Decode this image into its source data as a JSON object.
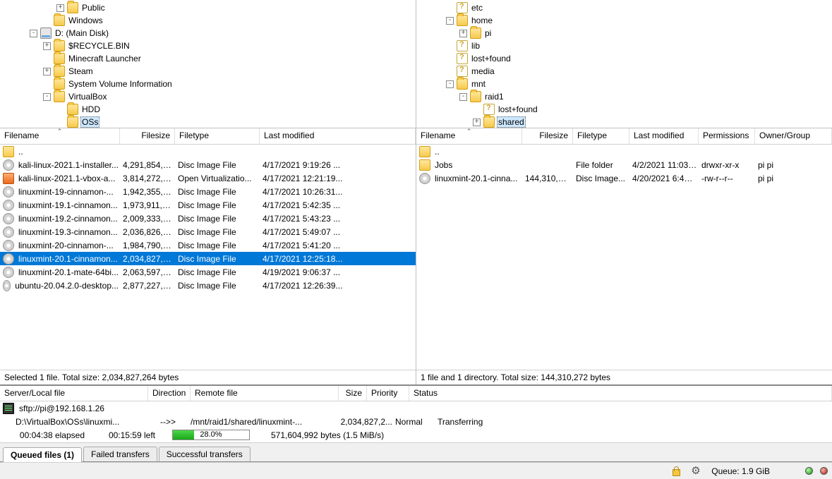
{
  "local_tree": [
    {
      "depth": 4,
      "exp": "+",
      "icon": "folder",
      "label": "Public"
    },
    {
      "depth": 3,
      "exp": "",
      "icon": "folder",
      "label": "Windows"
    },
    {
      "depth": 2,
      "exp": "-",
      "icon": "disk",
      "label": "D: (Main Disk)"
    },
    {
      "depth": 3,
      "exp": "+",
      "icon": "folder",
      "label": "$RECYCLE.BIN"
    },
    {
      "depth": 3,
      "exp": "",
      "icon": "folder",
      "label": "Minecraft Launcher"
    },
    {
      "depth": 3,
      "exp": "+",
      "icon": "folder",
      "label": "Steam"
    },
    {
      "depth": 3,
      "exp": "",
      "icon": "folder",
      "label": "System Volume Information"
    },
    {
      "depth": 3,
      "exp": "-",
      "icon": "folder",
      "label": "VirtualBox"
    },
    {
      "depth": 4,
      "exp": "",
      "icon": "folder",
      "label": "HDD"
    },
    {
      "depth": 4,
      "exp": "",
      "icon": "folder",
      "label": "OSs",
      "selected": true
    }
  ],
  "remote_tree": [
    {
      "depth": 2,
      "exp": "",
      "icon": "unknown",
      "label": "etc"
    },
    {
      "depth": 2,
      "exp": "-",
      "icon": "folder",
      "label": "home"
    },
    {
      "depth": 3,
      "exp": "+",
      "icon": "folder",
      "label": "pi"
    },
    {
      "depth": 2,
      "exp": "",
      "icon": "unknown",
      "label": "lib"
    },
    {
      "depth": 2,
      "exp": "",
      "icon": "unknown",
      "label": "lost+found"
    },
    {
      "depth": 2,
      "exp": "",
      "icon": "unknown",
      "label": "media"
    },
    {
      "depth": 2,
      "exp": "-",
      "icon": "folder",
      "label": "mnt"
    },
    {
      "depth": 3,
      "exp": "-",
      "icon": "folder",
      "label": "raid1"
    },
    {
      "depth": 4,
      "exp": "",
      "icon": "unknown",
      "label": "lost+found"
    },
    {
      "depth": 4,
      "exp": "+",
      "icon": "folder",
      "label": "shared",
      "selected": true
    }
  ],
  "list_cols": {
    "local": [
      "Filename",
      "Filesize",
      "Filetype",
      "Last modified"
    ],
    "remote": [
      "Filename",
      "Filesize",
      "Filetype",
      "Last modified",
      "Permissions",
      "Owner/Group"
    ]
  },
  "local_files": [
    {
      "icon": "dir",
      "name": "..",
      "size": "",
      "type": "",
      "mod": ""
    },
    {
      "icon": "cd",
      "name": "kali-linux-2021.1-installer...",
      "size": "4,291,854,3...",
      "type": "Disc Image File",
      "mod": "4/17/2021 9:19:26 ..."
    },
    {
      "icon": "box",
      "name": "kali-linux-2021.1-vbox-a...",
      "size": "3,814,272,0...",
      "type": "Open Virtualizatio...",
      "mod": "4/17/2021 12:21:19..."
    },
    {
      "icon": "cd",
      "name": "linuxmint-19-cinnamon-...",
      "size": "1,942,355,9...",
      "type": "Disc Image File",
      "mod": "4/17/2021 10:26:31..."
    },
    {
      "icon": "cd",
      "name": "linuxmint-19.1-cinnamon...",
      "size": "1,973,911,5...",
      "type": "Disc Image File",
      "mod": "4/17/2021 5:42:35 ..."
    },
    {
      "icon": "cd",
      "name": "linuxmint-19.2-cinnamon...",
      "size": "2,009,333,7...",
      "type": "Disc Image File",
      "mod": "4/17/2021 5:43:23 ..."
    },
    {
      "icon": "cd",
      "name": "linuxmint-19.3-cinnamon...",
      "size": "2,036,826,1...",
      "type": "Disc Image File",
      "mod": "4/17/2021 5:49:07 ..."
    },
    {
      "icon": "cd",
      "name": "linuxmint-20-cinnamon-...",
      "size": "1,984,790,5...",
      "type": "Disc Image File",
      "mod": "4/17/2021 5:41:20 ..."
    },
    {
      "icon": "cd",
      "name": "linuxmint-20.1-cinnamon...",
      "size": "2,034,827,2...",
      "type": "Disc Image File",
      "mod": "4/17/2021 12:25:18...",
      "selected": true
    },
    {
      "icon": "cd",
      "name": "linuxmint-20.1-mate-64bi...",
      "size": "2,063,597,5...",
      "type": "Disc Image File",
      "mod": "4/19/2021 9:06:37 ..."
    },
    {
      "icon": "cd",
      "name": "ubuntu-20.04.2.0-desktop...",
      "size": "2,877,227,0...",
      "type": "Disc Image File",
      "mod": "4/17/2021 12:26:39..."
    }
  ],
  "remote_files": [
    {
      "icon": "dir",
      "name": "..",
      "size": "",
      "type": "",
      "mod": "",
      "perm": "",
      "own": ""
    },
    {
      "icon": "dir",
      "name": "Jobs",
      "size": "",
      "type": "File folder",
      "mod": "4/2/2021 11:03:...",
      "perm": "drwxr-xr-x",
      "own": "pi pi"
    },
    {
      "icon": "cd",
      "name": "linuxmint-20.1-cinna...",
      "size": "144,310,272",
      "type": "Disc Image...",
      "mod": "4/20/2021 6:48:...",
      "perm": "-rw-r--r--",
      "own": "pi pi"
    }
  ],
  "local_status": "Selected 1 file. Total size: 2,034,827,264 bytes",
  "remote_status": "1 file and 1 directory. Total size: 144,310,272 bytes",
  "queue_cols": [
    "Server/Local file",
    "Direction",
    "Remote file",
    "Size",
    "Priority",
    "Status"
  ],
  "server_line": "sftp://pi@192.168.1.26",
  "transfer": {
    "local_file": "D:\\VirtualBox\\OSs\\linuxmi...",
    "direction": "-->>",
    "remote_file": "/mnt/raid1/shared/linuxmint-...",
    "size": "2,034,827,2...",
    "priority": "Normal",
    "status": "Transferring",
    "elapsed": "00:04:38 elapsed",
    "left": "00:15:59 left",
    "percent_num": 28,
    "percent": "28.0%",
    "bytes": "571,604,992 bytes (1.5 MiB/s)"
  },
  "tabs": {
    "queued": "Queued files (1)",
    "failed": "Failed transfers",
    "successful": "Successful transfers"
  },
  "statusbar": {
    "queue": "Queue: 1.9 GiB"
  }
}
